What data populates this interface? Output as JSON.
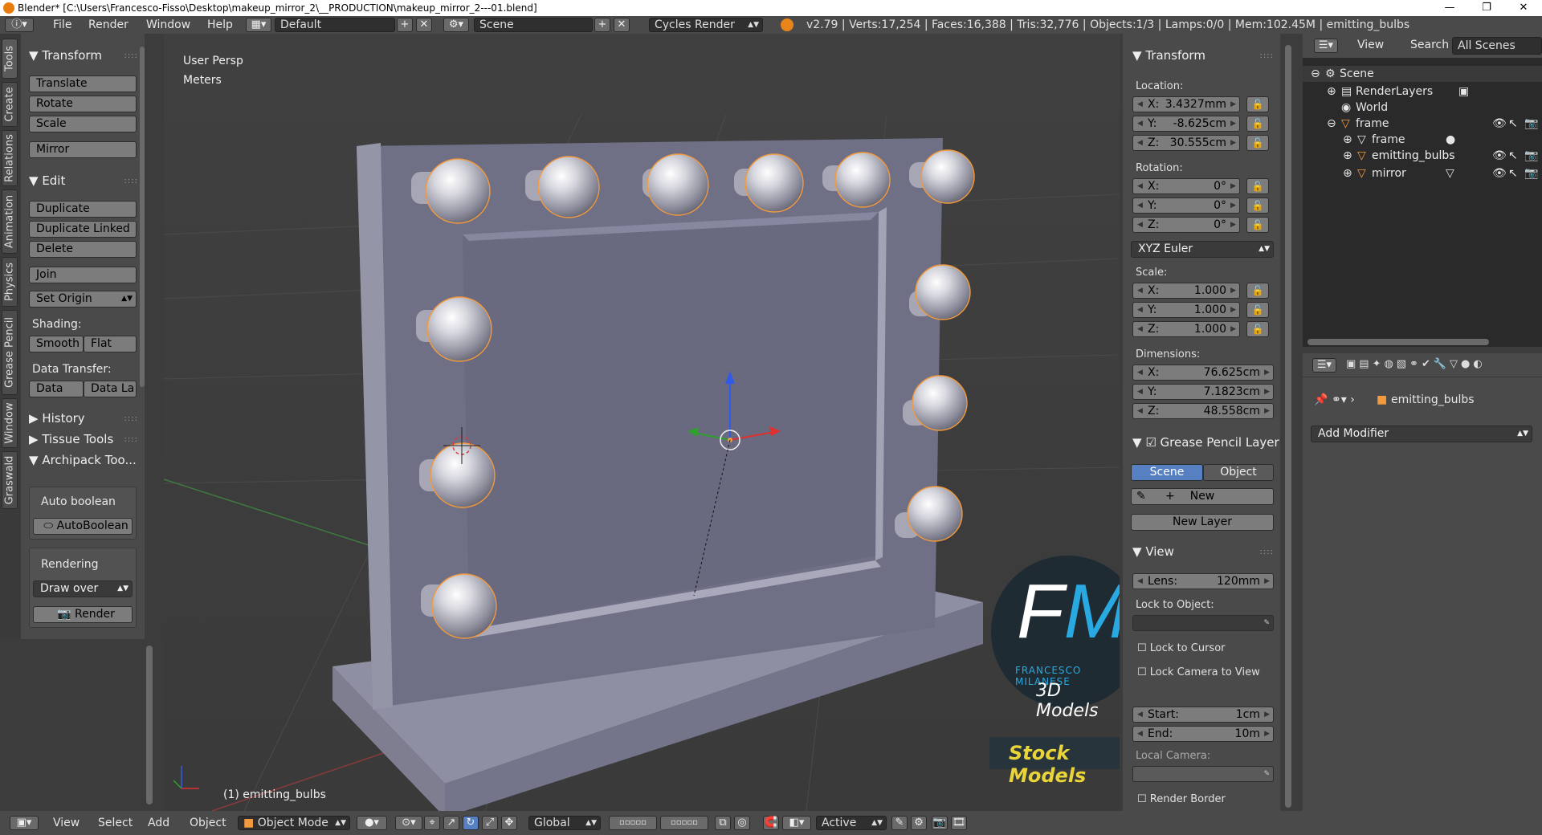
{
  "window": {
    "title": "Blender* [C:\\Users\\Francesco-Fisso\\Desktop\\makeup_mirror_2\\__PRODUCTION\\makeup_mirror_2---01.blend]",
    "minimize": "—",
    "restore": "❐",
    "close": "✕"
  },
  "topbar": {
    "menus": [
      "File",
      "Render",
      "Window",
      "Help"
    ],
    "layout": "Default",
    "scene": "Scene",
    "engine": "Cycles Render",
    "stats": "v2.79 | Verts:17,254 | Faces:16,388 | Tris:32,776 | Objects:1/3 | Lamps:0/0 | Mem:102.45M | emitting_bulbs"
  },
  "tabs": [
    "Tools",
    "Create",
    "Relations",
    "Animation",
    "Physics",
    "Grease Pencil",
    "Window",
    "Graswald"
  ],
  "toolshelf": {
    "transform_title": "Transform",
    "translate": "Translate",
    "rotate": "Rotate",
    "scale": "Scale",
    "mirror": "Mirror",
    "edit_title": "Edit",
    "duplicate": "Duplicate",
    "duplicate_linked": "Duplicate Linked",
    "delete": "Delete",
    "join": "Join",
    "set_origin": "Set Origin",
    "shading_label": "Shading:",
    "smooth": "Smooth",
    "flat": "Flat",
    "data_transfer_label": "Data Transfer:",
    "data": "Data",
    "data_la": "Data La",
    "history": "History",
    "tissue_tools": "Tissue Tools",
    "archipack": "Archipack Too...",
    "auto_boolean_label": "Auto boolean",
    "autoboolean_btn": "AutoBoolean",
    "rendering_label": "Rendering",
    "draw_over": "Draw over",
    "render_btn": "Render"
  },
  "viewport": {
    "view_name": "User Persp",
    "units": "Meters",
    "object_label": "(1) emitting_bulbs"
  },
  "npanel": {
    "transform_title": "Transform",
    "location_label": "Location:",
    "location": [
      {
        "axis": "X:",
        "value": "3.4327mm"
      },
      {
        "axis": "Y:",
        "value": "-8.625cm"
      },
      {
        "axis": "Z:",
        "value": "30.555cm"
      }
    ],
    "rotation_label": "Rotation:",
    "rotation": [
      {
        "axis": "X:",
        "value": "0°"
      },
      {
        "axis": "Y:",
        "value": "0°"
      },
      {
        "axis": "Z:",
        "value": "0°"
      }
    ],
    "rotation_mode": "XYZ Euler",
    "scale_label": "Scale:",
    "scale": [
      {
        "axis": "X:",
        "value": "1.000"
      },
      {
        "axis": "Y:",
        "value": "1.000"
      },
      {
        "axis": "Z:",
        "value": "1.000"
      }
    ],
    "dimensions_label": "Dimensions:",
    "dimensions": [
      {
        "axis": "X:",
        "value": "76.625cm"
      },
      {
        "axis": "Y:",
        "value": "7.1823cm"
      },
      {
        "axis": "Z:",
        "value": "48.558cm"
      }
    ],
    "gp_title": "Grease Pencil Layer",
    "gp_scene": "Scene",
    "gp_object": "Object",
    "gp_new": "New",
    "gp_new_layer": "New Layer",
    "view_title": "View",
    "lens_label": "Lens:",
    "lens_value": "120mm",
    "lock_object": "Lock to Object:",
    "lock_cursor": "Lock to Cursor",
    "lock_camera": "Lock Camera to View",
    "clip_start_label": "Start:",
    "clip_start": "1cm",
    "clip_end_label": "End:",
    "clip_end": "10m",
    "local_camera": "Local Camera:",
    "render_border": "Render Border"
  },
  "outliner": {
    "view": "View",
    "search": "Search",
    "filter": "All Scenes",
    "items": [
      "Scene",
      "RenderLayers",
      "World",
      "frame",
      "frame",
      "emitting_bulbs",
      "mirror"
    ]
  },
  "properties": {
    "breadcrumb_object": "emitting_bulbs",
    "add_modifier": "Add Modifier"
  },
  "bottombar": {
    "view": "View",
    "select": "Select",
    "add": "Add",
    "object": "Object",
    "mode": "Object Mode",
    "orientation": "Global",
    "pivot_active": "Active"
  },
  "watermark": {
    "logo_letters": "FM",
    "author": "FRANCESCO MILANESE",
    "subtitle": "3D Models",
    "banner": "Stock Models"
  },
  "colors": {
    "accent_blue": "#5680c2",
    "selected_outline": "#f29a3d",
    "mirror_surface": "#6f6f86",
    "logo_blue": "#29a9e1",
    "banner_yellow": "#e9d43a"
  }
}
